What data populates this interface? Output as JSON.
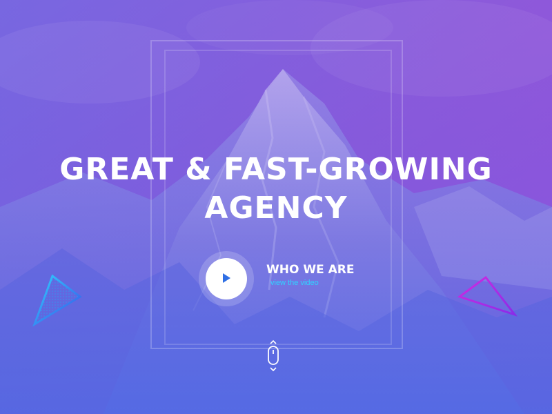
{
  "hero": {
    "headline_line1": "GREAT & FAST-GROWING",
    "headline_line2": "AGENCY",
    "video_title": "WHO WE ARE",
    "video_link": "view the video"
  },
  "colors": {
    "gradient_top": "#a14fd8",
    "gradient_bottom": "#5a6fe6",
    "accent_cyan": "#2fd3ff",
    "accent_magenta": "#d02be0",
    "play_icon": "#2f6fe4"
  },
  "icons": {
    "play": "play-icon",
    "scroll": "mouse-scroll-icon",
    "left_triangle": "triangle-decor-icon",
    "right_triangle": "triangle-decor-icon"
  }
}
